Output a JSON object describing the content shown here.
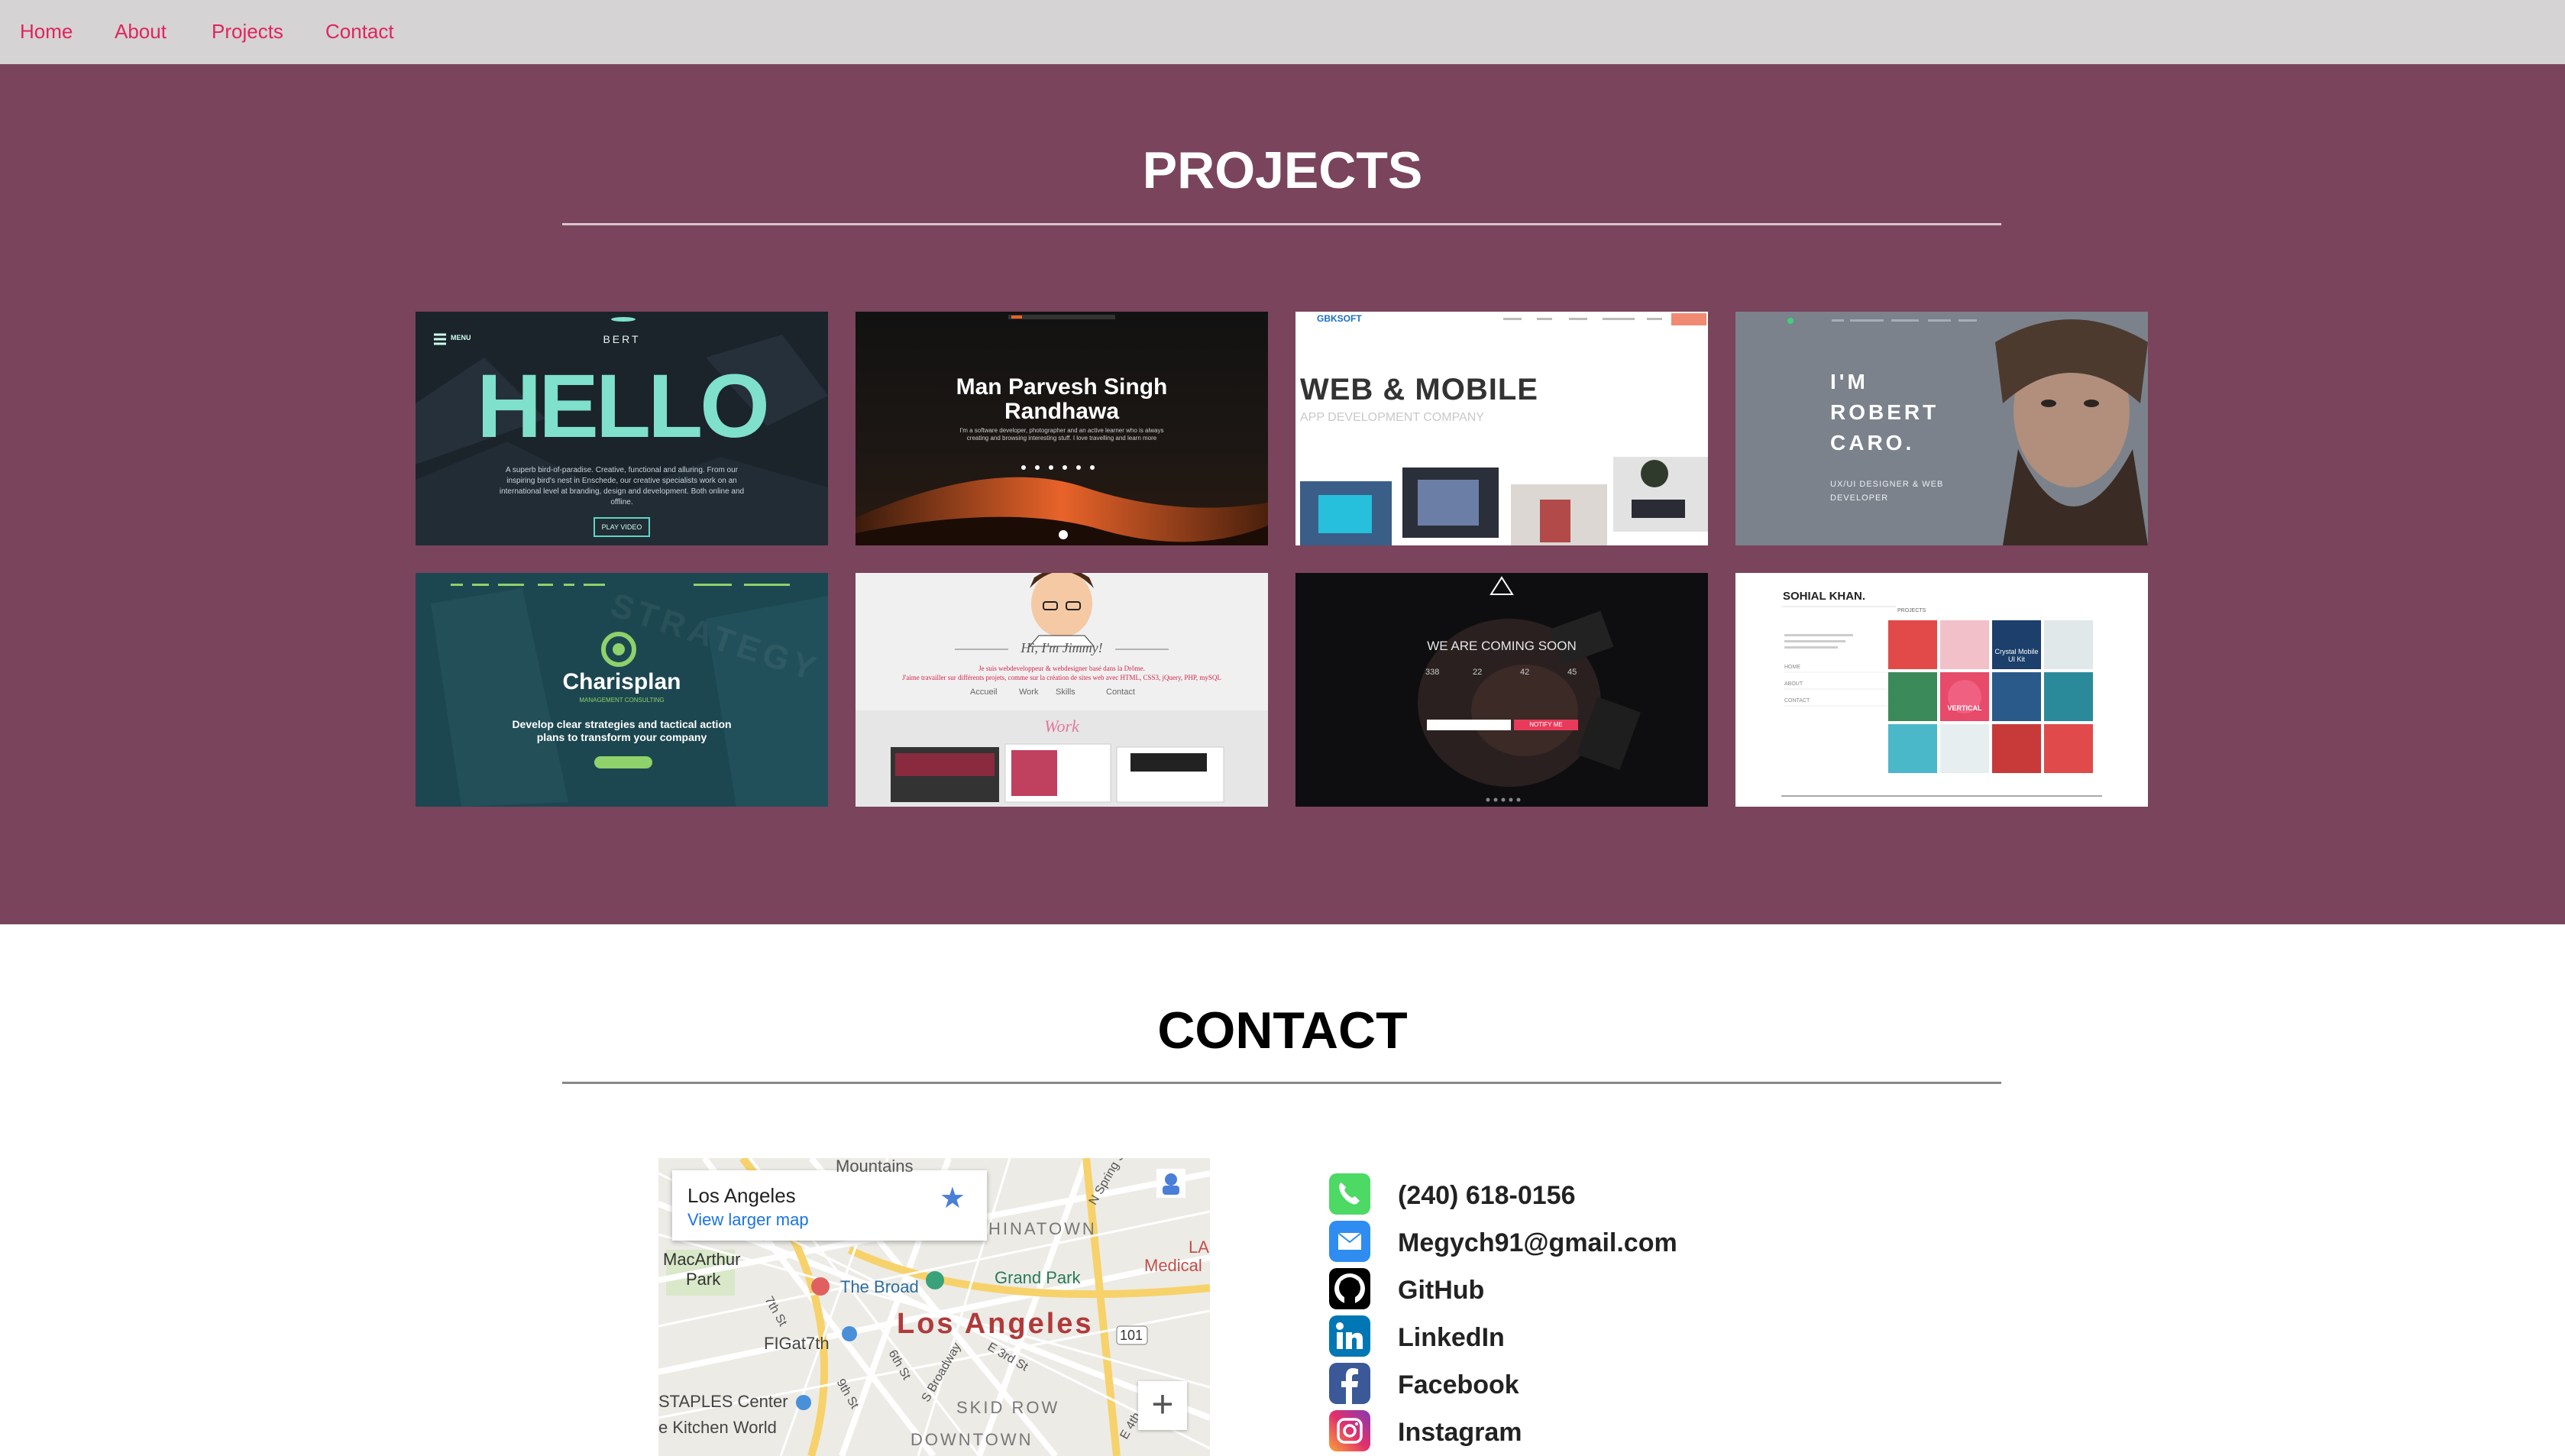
{
  "nav": {
    "items": [
      {
        "label": "Home"
      },
      {
        "label": "About"
      },
      {
        "label": "Projects"
      },
      {
        "label": "Contact"
      }
    ]
  },
  "projects": {
    "title": "PROJECTS",
    "thumbs": [
      {
        "heading": "HELLO",
        "sub": "BERT",
        "menu": "MENU",
        "button": "PLAY VIDEO"
      },
      {
        "heading": "Man Parvesh Singh",
        "heading2": "Randhawa"
      },
      {
        "brand": "GBKSOFT",
        "heading": "WEB & MOBILE",
        "sub": "APP DEVELOPMENT COMPANY"
      },
      {
        "heading": "I'M",
        "heading2": "ROBERT",
        "heading3": "CARO.",
        "sub": "UX/UI DESIGNER & WEB",
        "sub2": "DEVELOPER"
      },
      {
        "heading": "Charisplan",
        "sub": "MANAGEMENT CONSULTING",
        "tagline": "Develop clear strategies and tactical action",
        "tagline2": "plans to transform your company",
        "bg": "STRATEGY"
      },
      {
        "heading": "Hi, I'm Jimmy!",
        "links": [
          "Accueil",
          "Work",
          "Skills",
          "Contact"
        ],
        "work": "Work"
      },
      {
        "heading": "WE ARE COMING SOON",
        "counters": [
          "338",
          "22",
          "42",
          "45"
        ],
        "button": "NOTIFY ME"
      },
      {
        "heading": "SOHIAL KHAN.",
        "items": [
          "PROJECTS",
          "HOME",
          "ABOUT",
          "CONTACT"
        ],
        "tile1": "Crystal Mobile UI Kit",
        "tile2": "VERTICAL"
      }
    ]
  },
  "contact": {
    "title": "CONTACT",
    "map": {
      "place": "Los Angeles",
      "link": "View larger map",
      "big_label": "Los Angeles",
      "labels": [
        "Mountains",
        "HINATOWN",
        "MacArthur",
        "Park",
        "The Broad",
        "Grand Park",
        "FIGat7th",
        "STAPLES Center",
        "e Kitchen World",
        "SKID ROW",
        "DOWNTOWN",
        "LA",
        "Medical",
        "101",
        "N Spring St",
        "7th St",
        "9th St",
        "6th St",
        "S Broadway",
        "E 3rd St",
        "E 4th"
      ],
      "zoom": "+"
    },
    "items": [
      {
        "label": "(240) 618-0156",
        "icon": "phone-icon",
        "color": "#4cd964"
      },
      {
        "label": "Megych91@gmail.com",
        "icon": "mail-icon",
        "color": "#2f8cf1"
      },
      {
        "label": "GitHub",
        "icon": "github-icon",
        "color": "#000000"
      },
      {
        "label": "LinkedIn",
        "icon": "linkedin-icon",
        "color": "#0077b5"
      },
      {
        "label": "Facebook",
        "icon": "facebook-icon",
        "color": "#3b5998"
      },
      {
        "label": "Instagram",
        "icon": "instagram-icon",
        "color": "#c13584"
      }
    ]
  },
  "colors": {
    "nav_bg": "#d5d3d4",
    "nav_link": "#e0245e",
    "projects_bg": "#7a445c"
  }
}
